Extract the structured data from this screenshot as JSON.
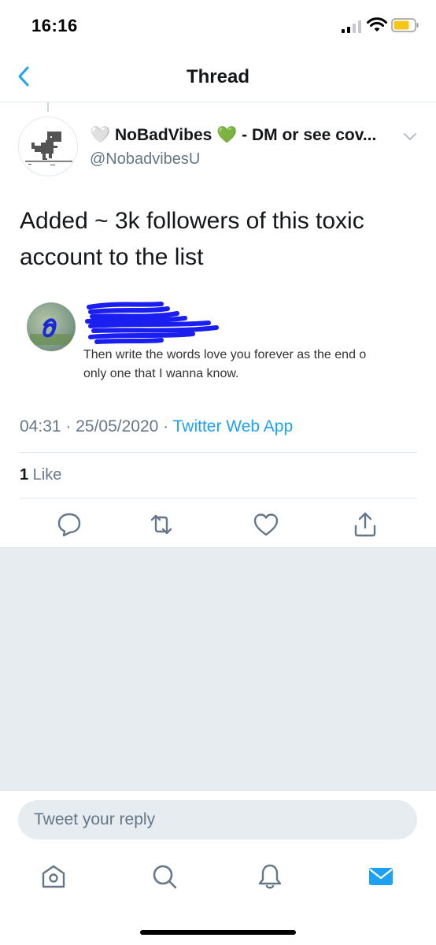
{
  "status_bar": {
    "time": "16:16"
  },
  "header": {
    "title": "Thread"
  },
  "tweet": {
    "author": {
      "heart_white": "🤍",
      "name": "NoBadVibes",
      "heart_green": "💚",
      "name_suffix": " - DM or see cov...",
      "handle": "@NobadvibesU"
    },
    "text": "Added ~ 3k followers of this toxic account to the list",
    "embedded_image": {
      "line1": "Then write the words love you forever as the end o",
      "line2": "only one that I wanna know."
    },
    "timestamp": "04:31 · 25/05/2020 · ",
    "source": "Twitter Web App",
    "like_count": "1",
    "like_label": " Like"
  },
  "reply": {
    "placeholder": "Tweet your reply"
  },
  "colors": {
    "accent": "#1da1f2",
    "secondary_text": "#657786",
    "background_gray": "#e6ecf0"
  },
  "icons": {
    "back": "chevron-left-icon",
    "more": "chevron-down-icon",
    "reply": "comment-icon",
    "retweet": "retweet-icon",
    "like": "heart-icon",
    "share": "share-icon",
    "tab_home": "home-icon",
    "tab_search": "search-icon",
    "tab_notifications": "bell-icon",
    "tab_messages": "envelope-icon"
  }
}
